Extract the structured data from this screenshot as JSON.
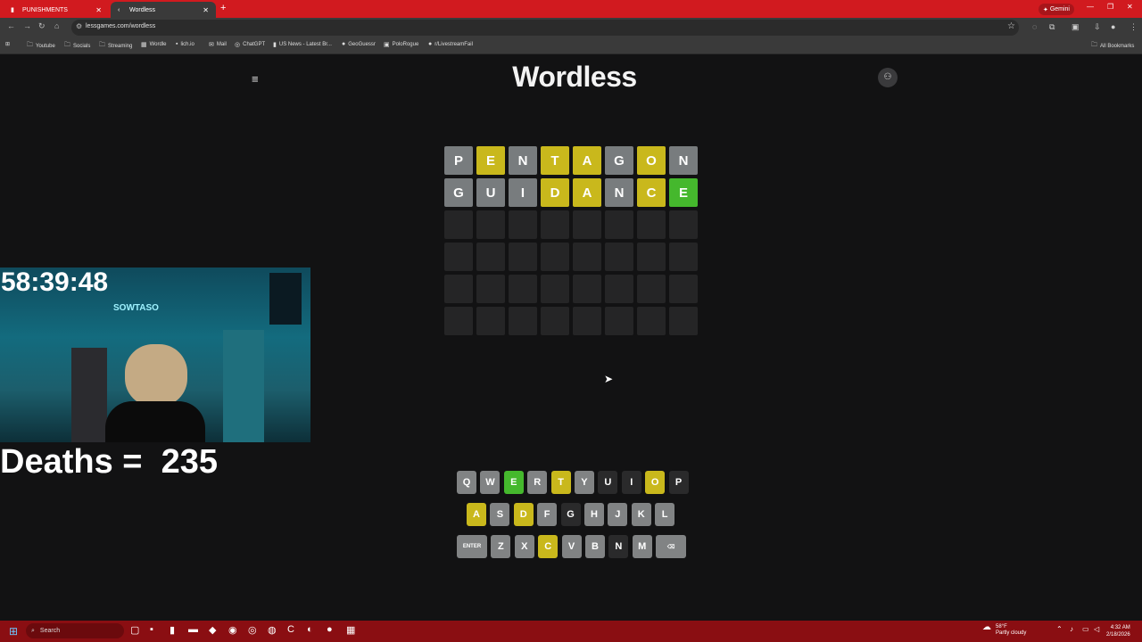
{
  "browser": {
    "tabs": [
      {
        "label": "PUNISHMENTS",
        "favicon": "app-icon"
      },
      {
        "label": "Wordless",
        "favicon": "chevron-left-icon"
      }
    ],
    "gemini_label": "Gemini",
    "url": "lessgames.com/wordless",
    "bookmarks": [
      {
        "label": "Youtube",
        "icon": "folder-icon"
      },
      {
        "label": "Socials",
        "icon": "folder-icon"
      },
      {
        "label": "Streaming",
        "icon": "folder-icon"
      },
      {
        "label": "Wordle",
        "icon": "grid-icon"
      },
      {
        "label": "lich.io",
        "icon": "app-icon"
      },
      {
        "label": "Mail",
        "icon": "mail-icon"
      },
      {
        "label": "ChatGPT",
        "icon": "chatgpt-icon"
      },
      {
        "label": "US News - Latest Br...",
        "icon": "news-icon"
      },
      {
        "label": "GeoGuessr",
        "icon": "pin-icon"
      },
      {
        "label": "PoloRogue",
        "icon": "game-icon"
      },
      {
        "label": "r/LivestreamFail",
        "icon": "reddit-icon"
      }
    ],
    "all_bookmarks": "All Bookmarks"
  },
  "page": {
    "logo": "Wordless",
    "board": [
      [
        {
          "l": "P",
          "s": "gray"
        },
        {
          "l": "E",
          "s": "yellow"
        },
        {
          "l": "N",
          "s": "gray"
        },
        {
          "l": "T",
          "s": "yellow"
        },
        {
          "l": "A",
          "s": "yellow"
        },
        {
          "l": "G",
          "s": "gray"
        },
        {
          "l": "O",
          "s": "yellow"
        },
        {
          "l": "N",
          "s": "gray"
        }
      ],
      [
        {
          "l": "G",
          "s": "gray"
        },
        {
          "l": "U",
          "s": "gray"
        },
        {
          "l": "I",
          "s": "gray"
        },
        {
          "l": "D",
          "s": "yellow"
        },
        {
          "l": "A",
          "s": "yellow"
        },
        {
          "l": "N",
          "s": "gray"
        },
        {
          "l": "C",
          "s": "yellow"
        },
        {
          "l": "E",
          "s": "green"
        }
      ],
      [
        {
          "l": "",
          "s": "empty"
        },
        {
          "l": "",
          "s": "empty"
        },
        {
          "l": "",
          "s": "empty"
        },
        {
          "l": "",
          "s": "empty"
        },
        {
          "l": "",
          "s": "empty"
        },
        {
          "l": "",
          "s": "empty"
        },
        {
          "l": "",
          "s": "empty"
        },
        {
          "l": "",
          "s": "empty"
        }
      ],
      [
        {
          "l": "",
          "s": "empty"
        },
        {
          "l": "",
          "s": "empty"
        },
        {
          "l": "",
          "s": "empty"
        },
        {
          "l": "",
          "s": "empty"
        },
        {
          "l": "",
          "s": "empty"
        },
        {
          "l": "",
          "s": "empty"
        },
        {
          "l": "",
          "s": "empty"
        },
        {
          "l": "",
          "s": "empty"
        }
      ],
      [
        {
          "l": "",
          "s": "empty"
        },
        {
          "l": "",
          "s": "empty"
        },
        {
          "l": "",
          "s": "empty"
        },
        {
          "l": "",
          "s": "empty"
        },
        {
          "l": "",
          "s": "empty"
        },
        {
          "l": "",
          "s": "empty"
        },
        {
          "l": "",
          "s": "empty"
        },
        {
          "l": "",
          "s": "empty"
        }
      ],
      [
        {
          "l": "",
          "s": "empty"
        },
        {
          "l": "",
          "s": "empty"
        },
        {
          "l": "",
          "s": "empty"
        },
        {
          "l": "",
          "s": "empty"
        },
        {
          "l": "",
          "s": "empty"
        },
        {
          "l": "",
          "s": "empty"
        },
        {
          "l": "",
          "s": "empty"
        },
        {
          "l": "",
          "s": "empty"
        }
      ]
    ],
    "keyboard": [
      [
        {
          "k": "Q",
          "s": "gray"
        },
        {
          "k": "W",
          "s": "gray"
        },
        {
          "k": "E",
          "s": "green"
        },
        {
          "k": "R",
          "s": "gray"
        },
        {
          "k": "T",
          "s": "yellow"
        },
        {
          "k": "Y",
          "s": "gray"
        },
        {
          "k": "U",
          "s": "dark"
        },
        {
          "k": "I",
          "s": "dark"
        },
        {
          "k": "O",
          "s": "yellow"
        },
        {
          "k": "P",
          "s": "dark"
        }
      ],
      [
        {
          "k": "A",
          "s": "yellow"
        },
        {
          "k": "S",
          "s": "gray"
        },
        {
          "k": "D",
          "s": "yellow"
        },
        {
          "k": "F",
          "s": "gray"
        },
        {
          "k": "G",
          "s": "dark"
        },
        {
          "k": "H",
          "s": "gray"
        },
        {
          "k": "J",
          "s": "gray"
        },
        {
          "k": "K",
          "s": "gray"
        },
        {
          "k": "L",
          "s": "gray"
        }
      ],
      [
        {
          "k": "ENTER",
          "s": "gray",
          "wide": true
        },
        {
          "k": "Z",
          "s": "gray"
        },
        {
          "k": "X",
          "s": "gray"
        },
        {
          "k": "C",
          "s": "yellow"
        },
        {
          "k": "V",
          "s": "gray"
        },
        {
          "k": "B",
          "s": "gray"
        },
        {
          "k": "N",
          "s": "dark"
        },
        {
          "k": "M",
          "s": "gray"
        },
        {
          "k": "⌫",
          "s": "gray",
          "wide": true
        }
      ]
    ],
    "colors": {
      "gray": "#787c7e",
      "yellow": "#c9b81c",
      "green": "#45b82d",
      "empty": "#252526",
      "dark": "#2a2a2b"
    }
  },
  "overlay": {
    "timer": "58:39:48",
    "deaths": "Deaths =  235",
    "webcam_sign": "SOWTASO"
  },
  "taskbar": {
    "search_placeholder": "Search",
    "weather_temp": "58°F",
    "weather_desc": "Partly cloudy",
    "time": "4:32 AM",
    "date": "2/18/2026"
  }
}
